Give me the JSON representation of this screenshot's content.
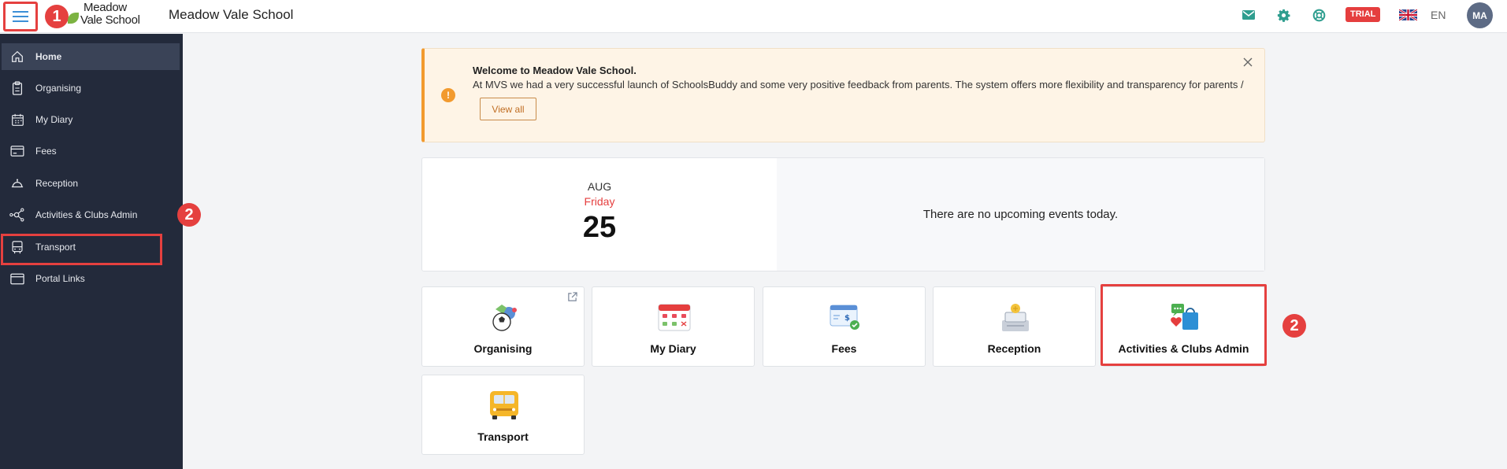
{
  "header": {
    "logo_line1": "Meadow",
    "logo_line2": "Vale School",
    "school_name": "Meadow Vale School",
    "trial_badge": "TRIAL",
    "language": "EN",
    "avatar_initials": "MA",
    "icons": [
      "mail-icon",
      "gear-icon",
      "help-icon",
      "uk-flag-icon"
    ]
  },
  "callouts": {
    "one": "1",
    "two": "2"
  },
  "sidebar": {
    "items": [
      {
        "label": "Home",
        "icon": "home-icon",
        "active": true
      },
      {
        "label": "Organising",
        "icon": "clipboard-icon"
      },
      {
        "label": "My Diary",
        "icon": "calendar-icon"
      },
      {
        "label": "Fees",
        "icon": "card-icon"
      },
      {
        "label": "Reception",
        "icon": "bell-icon"
      },
      {
        "label": "Activities & Clubs Admin",
        "icon": "network-icon"
      },
      {
        "label": "Transport",
        "icon": "bus-icon"
      },
      {
        "label": "Portal Links",
        "icon": "window-icon"
      }
    ]
  },
  "alert": {
    "title": "Welcome to Meadow Vale School.",
    "message": "At MVS we had a very successful launch of SchoolsBuddy and some very positive feedback from parents. The system offers more flexibility and transparency for parents /",
    "button": "View all"
  },
  "date_card": {
    "month": "AUG",
    "weekday": "Friday",
    "day": "25",
    "no_events": "There are no upcoming events today."
  },
  "tiles": [
    {
      "label": "Organising"
    },
    {
      "label": "My Diary"
    },
    {
      "label": "Fees"
    },
    {
      "label": "Reception"
    },
    {
      "label": "Activities & Clubs Admin"
    },
    {
      "label": "Transport"
    }
  ],
  "colors": {
    "accent_red": "#e5403f",
    "sidebar_bg": "#232a3b",
    "alert_orange": "#f29a2e",
    "link_blue": "#3c8fd6"
  }
}
